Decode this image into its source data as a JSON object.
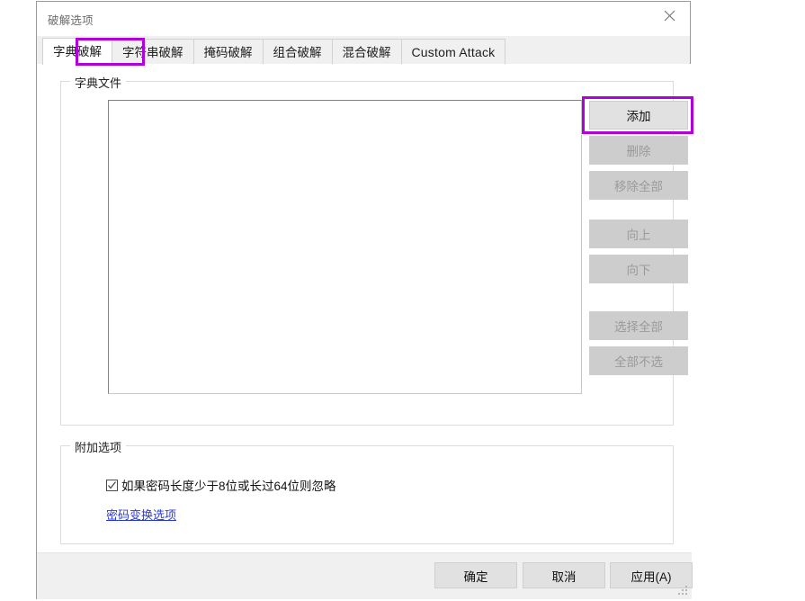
{
  "window": {
    "title": "破解选项",
    "close_icon": "close-icon"
  },
  "tabs": [
    {
      "label": "字典破解",
      "active": true
    },
    {
      "label": "字符串破解",
      "active": false
    },
    {
      "label": "掩码破解",
      "active": false
    },
    {
      "label": "组合破解",
      "active": false
    },
    {
      "label": "混合破解",
      "active": false
    },
    {
      "label": "Custom Attack",
      "active": false
    }
  ],
  "dictionary_group": {
    "legend": "字典文件",
    "listbox_items": [],
    "buttons": [
      {
        "label": "添加",
        "enabled": true
      },
      {
        "label": "删除",
        "enabled": false
      },
      {
        "label": "移除全部",
        "enabled": false
      },
      {
        "label": "向上",
        "enabled": false
      },
      {
        "label": "向下",
        "enabled": false
      },
      {
        "label": "选择全部",
        "enabled": false
      },
      {
        "label": "全部不选",
        "enabled": false
      }
    ]
  },
  "extra_group": {
    "legend": "附加选项",
    "checkbox": {
      "label": "如果密码长度少于8位或长过64位则忽略",
      "checked": true
    },
    "link": "密码变换选项"
  },
  "footer": {
    "ok": "确定",
    "cancel": "取消",
    "apply": "应用(A)"
  },
  "highlights": {
    "color": "#b200dd",
    "targets": [
      "字典破解",
      "添加"
    ]
  }
}
